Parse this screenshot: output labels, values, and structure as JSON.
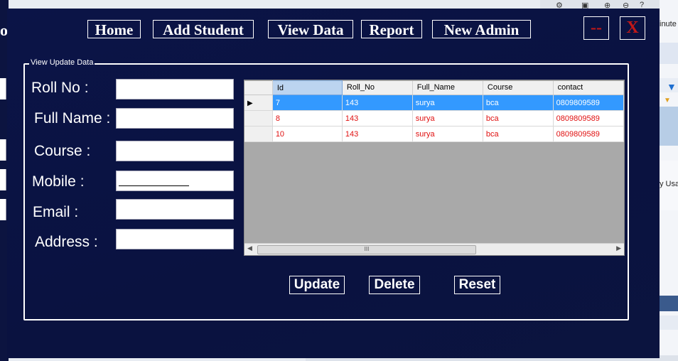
{
  "nav": {
    "home": "Home",
    "add_student": "Add Student",
    "view_data": "View Data",
    "report": "Report",
    "new_admin": "New Admin"
  },
  "window_controls": {
    "minimize": "--",
    "close": "X"
  },
  "group_title": "View  Update Data",
  "form": {
    "roll_no_label": "Roll No :",
    "full_name_label": "Full Name :",
    "course_label": "Course :",
    "mobile_label": "Mobile :",
    "email_label": "Email :",
    "address_label": "Address :",
    "roll_no_value": "",
    "full_name_value": "",
    "course_value": "",
    "mobile_value": "",
    "email_value": "",
    "address_value": ""
  },
  "grid": {
    "columns": [
      "Id",
      "Roll_No",
      "Full_Name",
      "Course",
      "contact"
    ],
    "rows": [
      [
        "7",
        "143",
        "surya",
        "bca",
        "0809809589"
      ],
      [
        "8",
        "143",
        "surya",
        "bca",
        "0809809589"
      ],
      [
        "10",
        "143",
        "surya",
        "bca",
        "0809809589"
      ]
    ],
    "scroll_grip": "III"
  },
  "actions": {
    "update": "Update",
    "delete": "Delete",
    "reset": "Reset"
  },
  "background": {
    "left_fragment": "or",
    "right_fragment_1": "inute",
    "right_fragment_2": "y Usa"
  },
  "colors": {
    "form_bg": "#0b1447",
    "selected_row": "#3399ff",
    "row_text": "#e01010",
    "window_control": "#c01818"
  }
}
